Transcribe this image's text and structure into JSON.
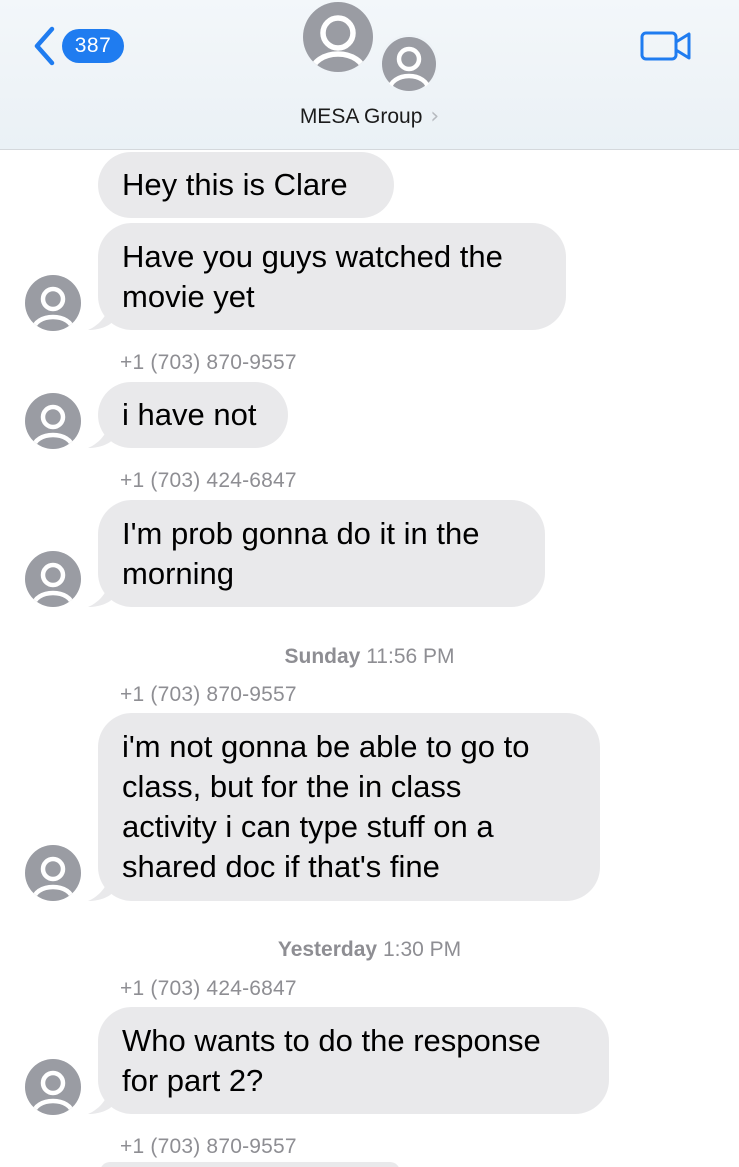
{
  "header": {
    "back_badge": "387",
    "group_name": "MESA Group",
    "group_chevron": "›",
    "back_icon": "chevron-left-icon",
    "video_icon": "video-camera-icon"
  },
  "colors": {
    "accent": "#1f7cf0",
    "bubble": "#e9e9eb",
    "avatar_bg": "#9a9ca3",
    "meta_text": "#8e8e93"
  },
  "messages": {
    "m1": {
      "lines": [
        "Hey this is Clare"
      ]
    },
    "m2": {
      "lines": [
        "Have you guys watched the",
        "movie yet"
      ]
    },
    "s1": "+1 (703) 870-9557",
    "m3": {
      "lines": [
        "i have not"
      ]
    },
    "s2": "+1 (703) 424-6847",
    "m4": {
      "lines": [
        "I'm prob gonna do it in the",
        "morning"
      ]
    },
    "t1": {
      "day": "Sunday",
      "time": "11:56 PM"
    },
    "s3": "+1 (703) 870-9557",
    "m5": {
      "lines": [
        "i'm not gonna be able to go to",
        "class, but for the in class",
        "activity i can type stuff on a",
        "shared doc if that's fine"
      ]
    },
    "t2": {
      "day": "Yesterday",
      "time": "1:30 PM"
    },
    "s4": "+1 (703) 424-6847",
    "m6": {
      "lines": [
        "Who wants to do the response",
        "for part 2?"
      ]
    },
    "s5": "+1 (703) 870-9557"
  }
}
